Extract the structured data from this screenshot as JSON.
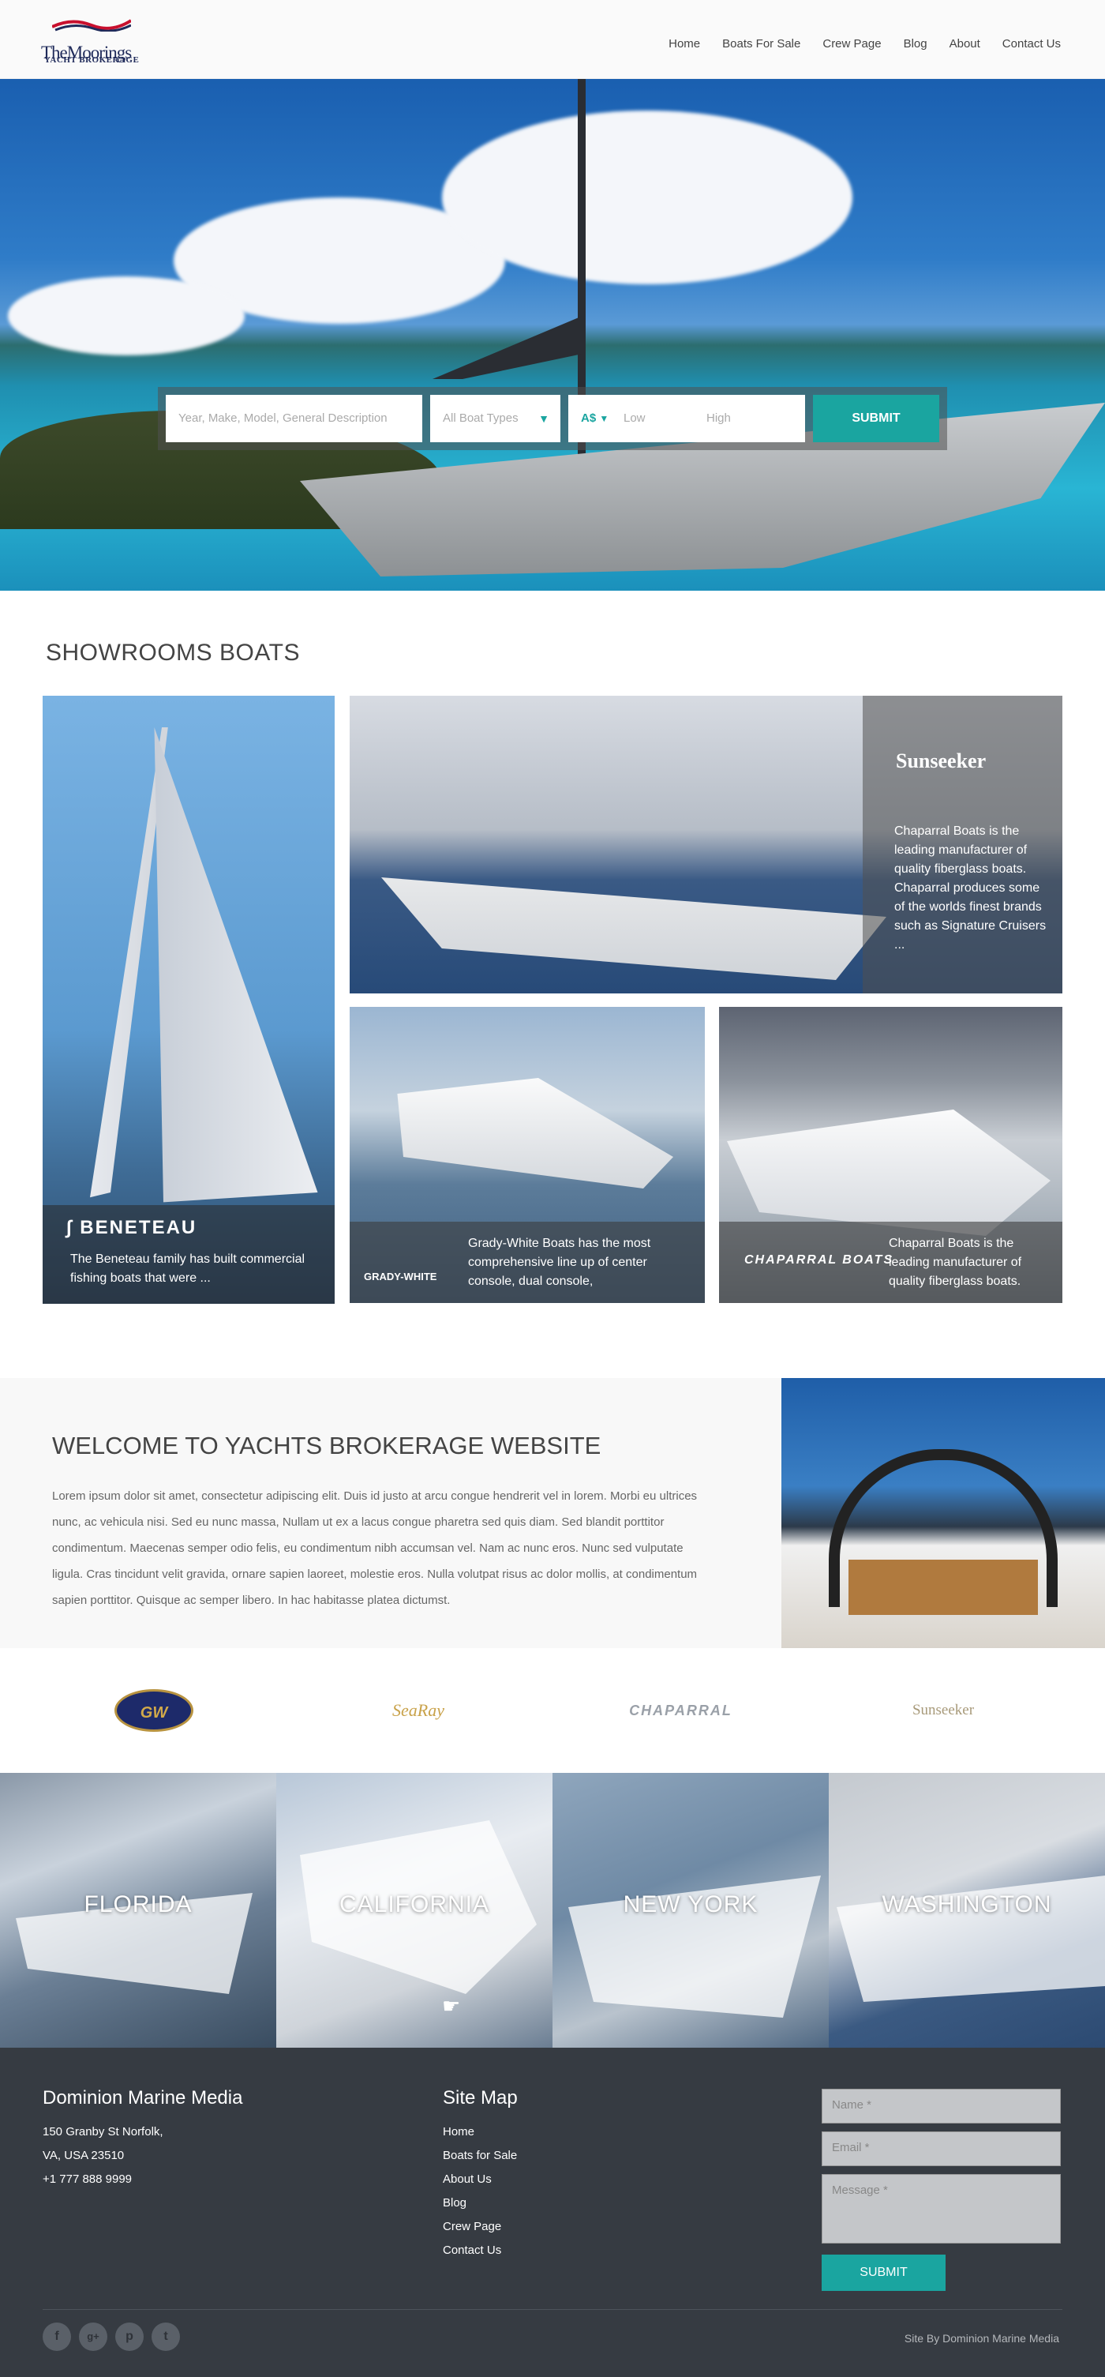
{
  "header": {
    "logo_text": "TheMoorings",
    "logo_sub": "YACHT BROKERAGE",
    "nav": [
      "Home",
      "Boats For Sale",
      "Crew Page",
      "Blog",
      "About",
      "Contact Us"
    ]
  },
  "search": {
    "keyword_placeholder": "Year, Make, Model, General Description",
    "boat_type": "All Boat Types",
    "currency": "A$",
    "low_placeholder": "Low",
    "high_placeholder": "High",
    "submit_label": "SUBMIT"
  },
  "showrooms": {
    "title": "SHOWROOMS BOATS",
    "cards": [
      {
        "brand": "BENETEAU",
        "text": "The Beneteau family has built commercial fishing boats that were ..."
      },
      {
        "brand": "Sunseeker",
        "text": "Chaparral Boats is the leading manufacturer of quality fiberglass boats. Chaparral produces some of the worlds finest brands such as Signature Cruisers ..."
      },
      {
        "brand": "GRADY-WHITE",
        "text": "Grady-White Boats has the most comprehensive line up of center console, dual console,"
      },
      {
        "brand": "CHAPARRAL BOATS",
        "text": "Chaparral Boats is the leading manufacturer of quality fiberglass boats."
      }
    ]
  },
  "welcome": {
    "title": "WELCOME TO YACHTS BROKERAGE WEBSITE",
    "body": "Lorem ipsum dolor sit amet, consectetur adipiscing elit. Duis id justo at arcu congue hendrerit vel in lorem. Morbi eu ultrices nunc, ac vehicula nisi. Sed eu nunc massa, Nullam ut ex a lacus congue pharetra sed quis diam. Sed blandit porttitor condimentum. Maecenas semper odio felis, eu condimentum nibh accumsan vel. Nam ac nunc eros. Nunc sed vulputate ligula. Cras tincidunt velit gravida, ornare sapien laoreet, molestie eros. Nulla volutpat risus ac dolor mollis, at condimentum sapien porttitor. Quisque ac semper libero. In hac habitasse platea dictumst."
  },
  "brands": [
    "GW",
    "SeaRay",
    "CHAPARRAL",
    "Sunseeker"
  ],
  "locations": [
    "FLORIDA",
    "CALIFORNIA",
    "NEW YORK",
    "WASHINGTON"
  ],
  "footer": {
    "company": "Dominion Marine Media",
    "address1": "150 Granby St Norfolk,",
    "address2": "VA, USA 23510",
    "phone": "+1 777 888 9999",
    "sitemap_title": "Site Map",
    "sitemap": [
      "Home",
      "Boats for Sale",
      "About Us",
      "Blog",
      "Crew Page",
      "Contact Us"
    ],
    "name_placeholder": "Name *",
    "email_placeholder": "Email *",
    "message_placeholder": "Message *",
    "submit_label": "SUBMIT",
    "social": [
      "f",
      "g+",
      "p",
      "t"
    ],
    "credit": "Site By Dominion Marine Media"
  }
}
